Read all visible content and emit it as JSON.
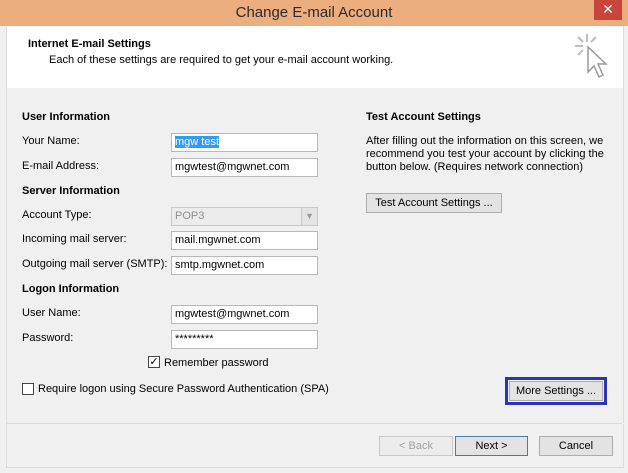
{
  "window": {
    "title": "Change E-mail Account",
    "close_label": "✕"
  },
  "header": {
    "title": "Internet E-mail Settings",
    "subtitle": "Each of these settings are required to get your e-mail account working."
  },
  "user_info": {
    "heading": "User Information",
    "name_label": "Your Name:",
    "name_value": "mgw test",
    "email_label": "E-mail Address:",
    "email_value": "mgwtest@mgwnet.com"
  },
  "server_info": {
    "heading": "Server Information",
    "account_type_label": "Account Type:",
    "account_type_value": "POP3",
    "incoming_label": "Incoming mail server:",
    "incoming_value": "mail.mgwnet.com",
    "outgoing_label": "Outgoing mail server (SMTP):",
    "outgoing_value": "smtp.mgwnet.com"
  },
  "logon_info": {
    "heading": "Logon Information",
    "username_label": "User Name:",
    "username_value": "mgwtest@mgwnet.com",
    "password_label": "Password:",
    "password_value": "*********",
    "remember_label": "Remember password",
    "remember_checked": true,
    "spa_label": "Require logon using Secure Password Authentication (SPA)",
    "spa_checked": false
  },
  "test_settings": {
    "heading": "Test Account Settings",
    "description_line1": "After filling out the information on this screen, we",
    "description_line2": "recommend you test your account by clicking the",
    "description_line3": "button below. (Requires network connection)",
    "button_label": "Test Account Settings ..."
  },
  "more_settings_label": "More Settings ...",
  "footer": {
    "back_label": "< Back",
    "next_label": "Next >",
    "cancel_label": "Cancel"
  },
  "colors": {
    "titlebar": "#ecae7f",
    "close": "#c7453b",
    "highlight_border": "#2b35b0",
    "selection": "#3399ff"
  }
}
